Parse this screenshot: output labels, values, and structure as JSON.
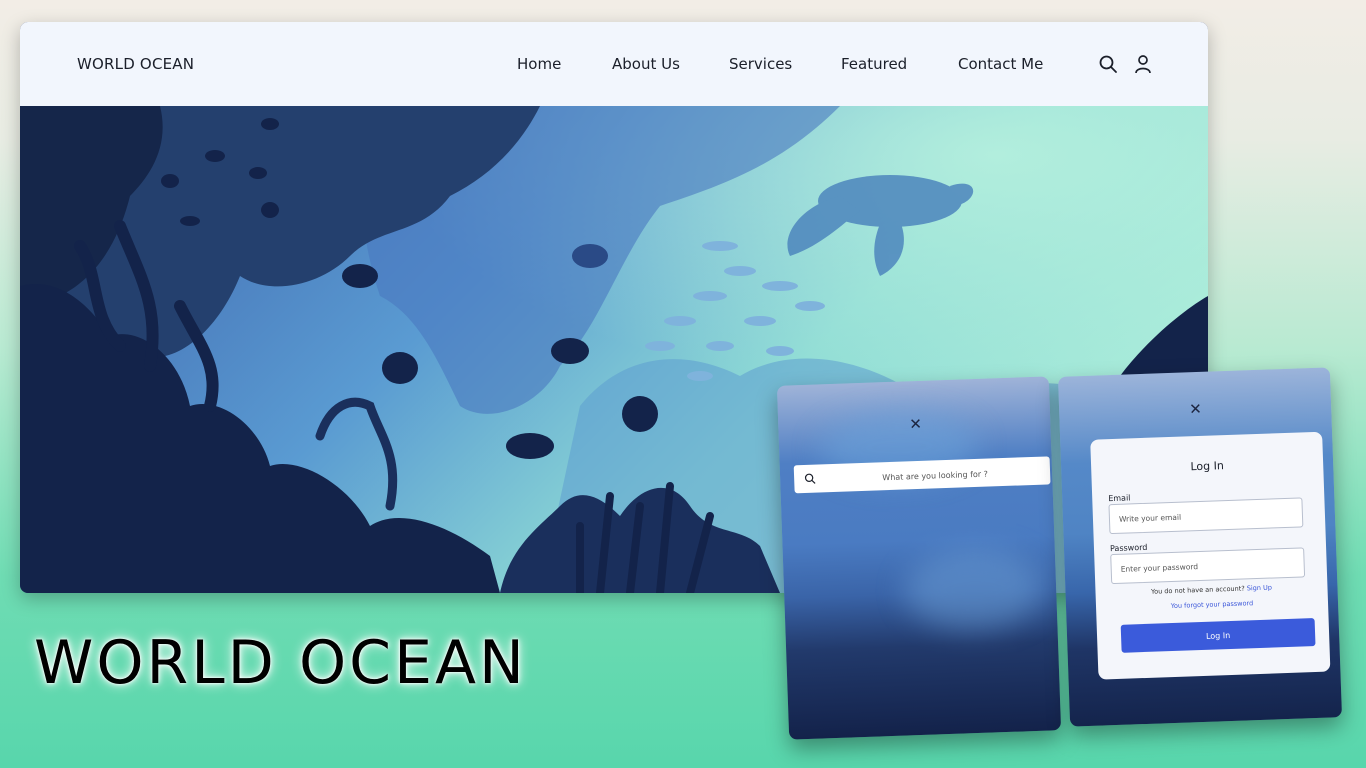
{
  "site": {
    "logo": "WORLD OCEAN",
    "nav": [
      {
        "label": "Home"
      },
      {
        "label": "About Us"
      },
      {
        "label": "Services"
      },
      {
        "label": "Featured"
      },
      {
        "label": "Contact Me"
      }
    ],
    "icons": [
      "search-icon",
      "user-icon"
    ]
  },
  "hero_image": "underwater coral reef illustration with fish and sea turtle",
  "big_title": "WORLD OCEAN",
  "search_modal": {
    "close_icon": "close-icon",
    "placeholder": "What are you looking for ?"
  },
  "login_modal": {
    "close_icon": "close-icon",
    "title": "Log In",
    "email_label": "Email",
    "email_placeholder": "Write your email",
    "password_label": "Password",
    "password_placeholder": "Enter your password",
    "signup_prompt": "You do not have an account?",
    "signup_link": "Sign Up",
    "forgot_link": "You forgot your password",
    "submit_label": "Log In"
  },
  "colors": {
    "accent": "#3b5bdb",
    "navbar_bg": "#f2f6fd",
    "page_bg_bottom": "#58d6ac",
    "ocean_deep": "#14244c",
    "ocean_light": "#9fe6d8"
  }
}
